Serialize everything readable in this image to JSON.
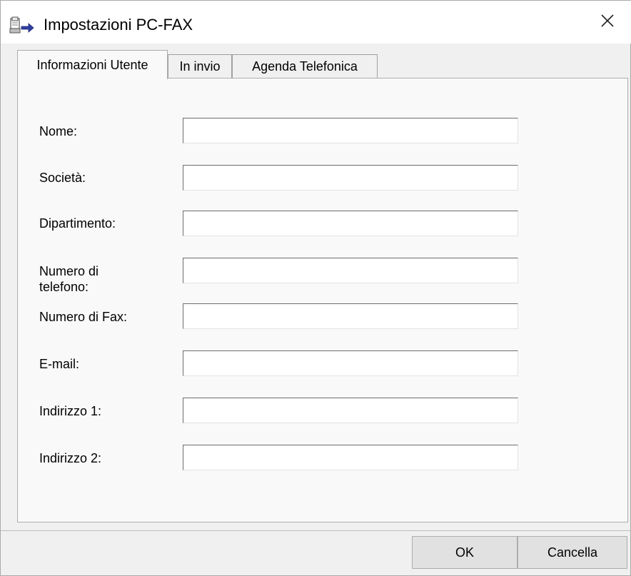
{
  "window": {
    "title": "Impostazioni PC-FAX",
    "app_icon": "pc-fax-icon",
    "close_icon": "close-icon"
  },
  "tabs": [
    {
      "label": "Informazioni Utente",
      "active": true
    },
    {
      "label": "In invio",
      "active": false
    },
    {
      "label": "Agenda Telefonica",
      "active": false
    }
  ],
  "fields": [
    {
      "label": "Nome:",
      "value": ""
    },
    {
      "label": "Società:",
      "value": ""
    },
    {
      "label": "Dipartimento:",
      "value": ""
    },
    {
      "label": "Numero di telefono:",
      "value": ""
    },
    {
      "label": "Numero di Fax:",
      "value": ""
    },
    {
      "label": "E-mail:",
      "value": ""
    },
    {
      "label": "Indirizzo 1:",
      "value": ""
    },
    {
      "label": "Indirizzo 2:",
      "value": ""
    }
  ],
  "buttons": {
    "ok": "OK",
    "cancel": "Cancella"
  }
}
